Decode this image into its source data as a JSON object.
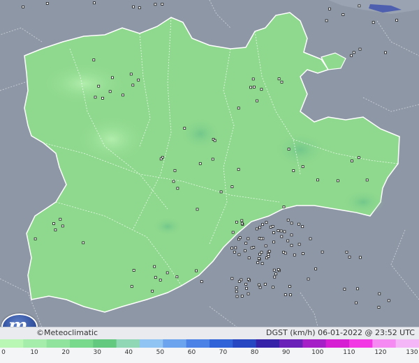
{
  "brand": {
    "logo_glyph": "m",
    "name": "©Meteoclimatic"
  },
  "map": {
    "label": "DGST (km/h)   06-01-2022 @ 23:52 UTC"
  },
  "scale": {
    "ticks": [
      "0",
      "10",
      "20",
      "30",
      "40",
      "50",
      "60",
      "70",
      "80",
      "90",
      "100",
      "110",
      "120",
      "130"
    ],
    "colors": [
      "#b9f7b5",
      "#a5edaa",
      "#8fe39c",
      "#78d88c",
      "#63c97e",
      "#8fd7b5",
      "#8fc4f3",
      "#6ca4ee",
      "#4c82e6",
      "#3062d8",
      "#2746c2",
      "#3622a8",
      "#6a21b7",
      "#a520c7",
      "#d61fd2",
      "#f238e5",
      "#f58af2",
      "#f5b6f7"
    ]
  },
  "colors": {
    "land": "#8e97a6",
    "region": "#8fd98e",
    "station": "#1b1b1b"
  }
}
